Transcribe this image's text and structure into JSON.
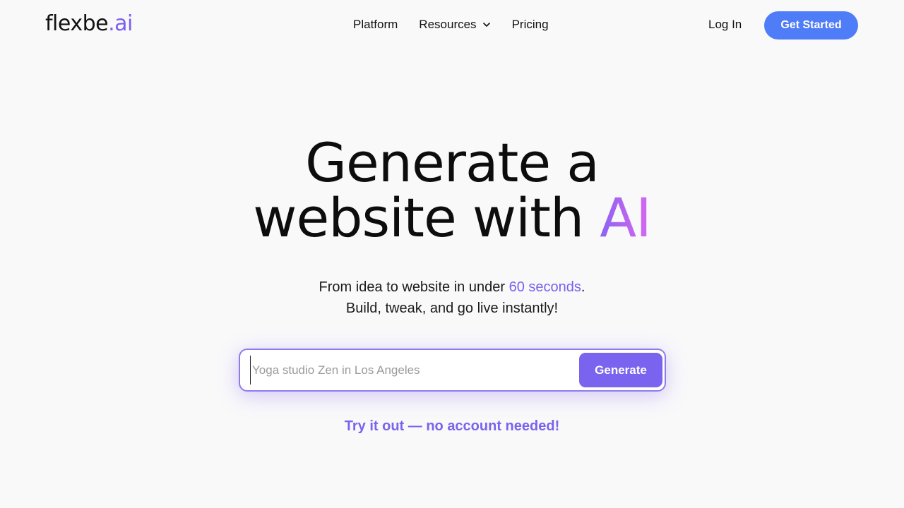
{
  "header": {
    "logo": {
      "main": "flexbe",
      "suffix": ".ai"
    },
    "nav": [
      {
        "label": "Platform"
      },
      {
        "label": "Resources",
        "icon": "chevron-down-icon"
      },
      {
        "label": "Pricing"
      }
    ],
    "login_label": "Log In",
    "cta_label": "Get Started"
  },
  "hero": {
    "title_line1": "Generate a",
    "title_line2_prefix": "website with ",
    "title_line2_highlight": "AI",
    "subtitle_line1_prefix": "From idea to website in under ",
    "subtitle_line1_highlight": "60 seconds",
    "subtitle_line1_suffix": ".",
    "subtitle_line2": "Build, tweak, and go live instantly!"
  },
  "generator": {
    "placeholder": "Yoga studio Zen in Los Angeles",
    "value": "",
    "button_label": "Generate"
  },
  "try_label": "Try it out — no account needed!",
  "colors": {
    "accent_purple": "#7a63ee",
    "cta_blue": "#4f7cf7",
    "background": "#f9f9fa"
  }
}
